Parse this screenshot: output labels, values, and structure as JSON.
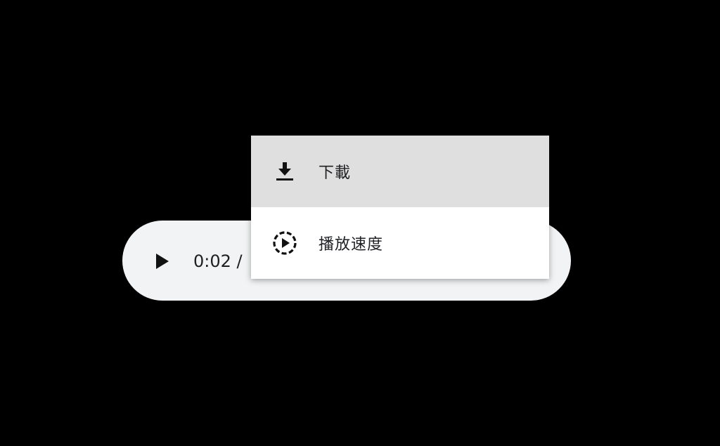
{
  "player": {
    "current_time": "0:02 /",
    "play_icon": "play-icon"
  },
  "menu": {
    "items": [
      {
        "label": "下載",
        "icon": "download-icon"
      },
      {
        "label": "播放速度",
        "icon": "playback-speed-icon"
      }
    ]
  },
  "colors": {
    "background": "#000000",
    "player": "#f1f3f4",
    "menu_hover": "#dfdfdf",
    "menu": "#ffffff"
  }
}
